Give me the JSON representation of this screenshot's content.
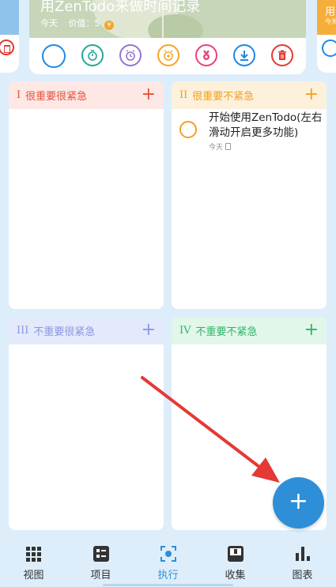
{
  "top_card": {
    "title": "用ZenTodo来做时间记录",
    "date": "今天",
    "value_label": "价值：",
    "value": "5",
    "coin_symbol": "¥"
  },
  "side_card_right": {
    "title": "用",
    "sub": "今天"
  },
  "action_icons": [
    "circle-icon",
    "stopwatch-icon",
    "clock-icon",
    "alarm-add-icon",
    "medal-icon",
    "download-icon",
    "delete-icon"
  ],
  "quadrants": [
    {
      "numeral": "I",
      "label": "很重要很紧急",
      "color": "#e8503a",
      "add": "+"
    },
    {
      "numeral": "II",
      "label": "很重要不紧急",
      "color": "#f2a020",
      "add": "+"
    },
    {
      "numeral": "III",
      "label": "不重要很紧急",
      "color": "#8a98e0",
      "add": "+"
    },
    {
      "numeral": "IV",
      "label": "不重要不紧急",
      "color": "#2fb46a",
      "add": "+"
    }
  ],
  "tasks": [
    {
      "title": "开始使用ZenTodo(左右滑动开启更多功能)",
      "date": "今天"
    }
  ],
  "fab": {
    "label": "+",
    "color": "#2f8ed8"
  },
  "nav": [
    {
      "label": "视图",
      "icon": "grid-icon"
    },
    {
      "label": "项目",
      "icon": "project-icon"
    },
    {
      "label": "执行",
      "icon": "focus-icon",
      "active": true
    },
    {
      "label": "收集",
      "icon": "inbox-icon"
    },
    {
      "label": "图表",
      "icon": "bar-chart-icon"
    }
  ],
  "colors": {
    "background": "#ddeefa",
    "accent": "#2f8ed8",
    "annotation_arrow": "#e53935"
  }
}
